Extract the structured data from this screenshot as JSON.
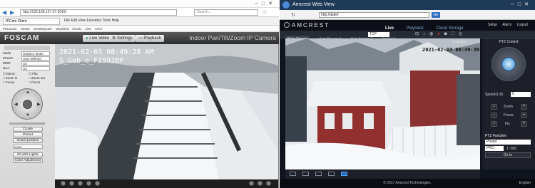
{
  "left_window": {
    "browser": {
      "address": "http://192.168.127.97:2015/",
      "search_placeholder": "Search...",
      "tab_title": "IPCam Client",
      "menu": [
        "File",
        "Edit",
        "View",
        "Favorites",
        "Tools",
        "Help"
      ],
      "favorites": [
        "PictoCam",
        "House",
        "SmokeyCam",
        "SkyShed",
        "NCSU",
        "Live",
        "Amcr"
      ]
    },
    "foscam": {
      "logo": "FOSCAM",
      "tabs": {
        "live": "Live Video",
        "settings": "Settings",
        "playback": "Playback"
      },
      "product_title": "Indoor Pan/Tilt/Zoom IP Camera",
      "fields": [
        {
          "label": "Mode",
          "value": "Outdoor Mode"
        },
        {
          "label": "Stream",
          "value": "User-defined"
        },
        {
          "label": "WDR",
          "value": "On"
        },
        {
          "label": "NAA",
          "value": "On"
        }
      ],
      "checks": [
        "Mirror",
        "Flip",
        "Zoom in",
        "Zoom out",
        "Focus",
        "Focus"
      ],
      "buttons": {
        "cruise": "Cruise",
        "preset": "Preset",
        "guard": "Guard position",
        "ir": "IR LED Lights",
        "color": "Color Adjustment"
      },
      "preset_value": "None",
      "overlay_time": "2021-02-03 08:49:28 AM",
      "overlay_name": "S_Gab_e_FI9928P"
    }
  },
  "right_window": {
    "browser": {
      "title": "Amcrest Web View",
      "address": "http://ipdel/",
      "go_label": "Go"
    },
    "amcrest": {
      "logo": "AMCREST",
      "nav": [
        "Live",
        "Playback",
        "Cloud Storage"
      ],
      "top_links": [
        "Setup",
        "Alarm",
        "Logout"
      ],
      "stream_tabs": [
        "Main Stream",
        "Sub Stream 1",
        "Sub Stream 2"
      ],
      "protocol_label": "Protocol",
      "protocol_value": "TCP",
      "overlay_time": "2021-02-03 08:49:30 Wed",
      "overlay_name": "IP2M-841",
      "ptz": {
        "title": "PTZ Control",
        "speed_label": "Speed(1-8)",
        "speed_value": "5",
        "zoom_label": "Zoom",
        "focus_label": "Focus",
        "iris_label": "Iris",
        "func_title": "PTZ Function",
        "func_value": "Preset",
        "func_sub": "PRO",
        "range": "1~300",
        "goto_label": "Go to"
      },
      "footer": "© 2017 Amcrest Technologies.",
      "footer_right": "English"
    }
  }
}
